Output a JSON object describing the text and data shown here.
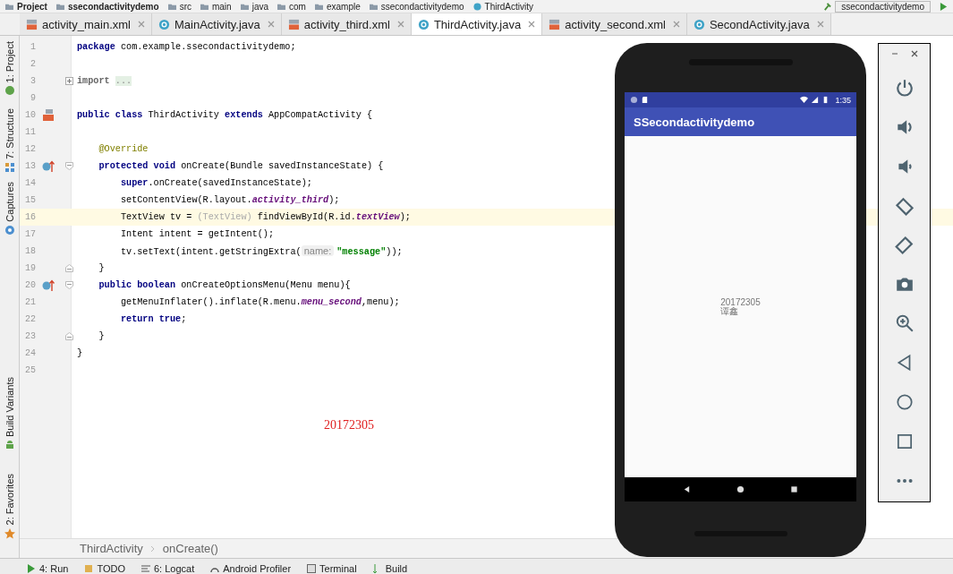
{
  "nav_bar": {
    "crumbs": [
      {
        "label": "Project",
        "kind": "project"
      },
      {
        "label": "ssecondactivitydemo",
        "kind": "module"
      },
      {
        "label": "src",
        "kind": "folder"
      },
      {
        "label": "main",
        "kind": "folder"
      },
      {
        "label": "java",
        "kind": "folder"
      },
      {
        "label": "com",
        "kind": "folder"
      },
      {
        "label": "example",
        "kind": "folder"
      },
      {
        "label": "ssecondactivitydemo",
        "kind": "folder"
      },
      {
        "label": "ThirdActivity",
        "kind": "class"
      }
    ],
    "run_config": "ssecondactivitydemo"
  },
  "tabs": [
    {
      "label": "activity_main.xml",
      "kind": "xml",
      "selected": false
    },
    {
      "label": "MainActivity.java",
      "kind": "java",
      "selected": false
    },
    {
      "label": "activity_third.xml",
      "kind": "xml",
      "selected": false
    },
    {
      "label": "ThirdActivity.java",
      "kind": "java",
      "selected": true
    },
    {
      "label": "activity_second.xml",
      "kind": "xml",
      "selected": false
    },
    {
      "label": "SecondActivity.java",
      "kind": "java",
      "selected": false
    }
  ],
  "left_tools": [
    {
      "label": "1: Project",
      "kind": "project"
    },
    {
      "label": "7: Structure",
      "kind": "structure"
    },
    {
      "label": "Captures",
      "kind": "captures"
    },
    {
      "label": "Build Variants",
      "kind": "variants"
    },
    {
      "label": "2: Favorites",
      "kind": "favorites"
    }
  ],
  "code_lines": [
    {
      "number": "1",
      "tokens": [
        {
          "text": "package",
          "kind": "keyword"
        },
        {
          "text": " com.example.ssecondactivitydemo;",
          "kind": "plain"
        }
      ]
    },
    {
      "number": "2"
    },
    {
      "number": "3",
      "folded": true,
      "tokens": [
        {
          "text": "import ",
          "kind": "import"
        },
        {
          "text": "...",
          "kind": "folded"
        }
      ]
    },
    {
      "number": "9"
    },
    {
      "number": "10",
      "class_marker": true,
      "tokens": [
        {
          "text": "public class",
          "kind": "keyword"
        },
        {
          "text": " ThirdActivity ",
          "kind": "plain"
        },
        {
          "text": "extends",
          "kind": "keyword"
        },
        {
          "text": " AppCompatActivity {",
          "kind": "plain"
        }
      ]
    },
    {
      "number": "11"
    },
    {
      "number": "12",
      "tokens": [
        {
          "text": "    @Override",
          "kind": "annotation"
        }
      ]
    },
    {
      "number": "13",
      "override_marker": true,
      "fold_start": true,
      "tokens": [
        {
          "text": "    protected void",
          "kind": "keyword"
        },
        {
          "text": " onCreate(Bundle savedInstanceState) {",
          "kind": "plain"
        }
      ]
    },
    {
      "number": "14",
      "tokens": [
        {
          "text": "        super",
          "kind": "keyword"
        },
        {
          "text": ".onCreate(savedInstanceState);",
          "kind": "plain"
        }
      ]
    },
    {
      "number": "15",
      "tokens": [
        {
          "text": "        setContentView(R.layout.",
          "kind": "plain"
        },
        {
          "text": "activity_third",
          "kind": "field"
        },
        {
          "text": ");",
          "kind": "plain"
        }
      ]
    },
    {
      "number": "16",
      "highlighted": true,
      "tokens": [
        {
          "text": "        TextView tv = ",
          "kind": "plain"
        },
        {
          "text": "(TextView)",
          "kind": "cast"
        },
        {
          "text": " findViewById(R.id.",
          "kind": "plain"
        },
        {
          "text": "textView",
          "kind": "field"
        },
        {
          "text": ");",
          "kind": "plain"
        }
      ]
    },
    {
      "number": "17",
      "tokens": [
        {
          "text": "        Intent intent = getIntent();",
          "kind": "plain"
        }
      ]
    },
    {
      "number": "18",
      "tokens": [
        {
          "text": "        tv.setText(intent.getStringExtra(",
          "kind": "plain"
        },
        {
          "text": "name:",
          "kind": "hint"
        },
        {
          "text": "\"message\"",
          "kind": "string"
        },
        {
          "text": "));",
          "kind": "plain"
        }
      ]
    },
    {
      "number": "19",
      "fold_end": true,
      "tokens": [
        {
          "text": "    }",
          "kind": "plain"
        }
      ]
    },
    {
      "number": "20",
      "override_marker": true,
      "fold_start": true,
      "tokens": [
        {
          "text": "    public boolean",
          "kind": "keyword"
        },
        {
          "text": " onCreateOptionsMenu(Menu menu){",
          "kind": "plain"
        }
      ]
    },
    {
      "number": "21",
      "tokens": [
        {
          "text": "        getMenuInflater().inflate(R.menu.",
          "kind": "plain"
        },
        {
          "text": "menu_second",
          "kind": "field"
        },
        {
          "text": ",menu);",
          "kind": "plain"
        }
      ]
    },
    {
      "number": "22",
      "tokens": [
        {
          "text": "        return true",
          "kind": "keyword"
        },
        {
          "text": ";",
          "kind": "plain"
        }
      ]
    },
    {
      "number": "23",
      "fold_end": true,
      "tokens": [
        {
          "text": "    }",
          "kind": "plain"
        }
      ]
    },
    {
      "number": "24",
      "tokens": [
        {
          "text": "}",
          "kind": "plain"
        }
      ]
    },
    {
      "number": "25"
    }
  ],
  "editor_note": "20172305",
  "breadcrumb": [
    "ThirdActivity",
    "onCreate()"
  ],
  "bottom_tools": [
    {
      "label": "4: Run",
      "kind": "run"
    },
    {
      "label": "TODO",
      "kind": "todo"
    },
    {
      "label": "6: Logcat",
      "kind": "logcat"
    },
    {
      "label": "Android Profiler",
      "kind": "profiler"
    },
    {
      "label": "Terminal",
      "kind": "terminal"
    },
    {
      "label": "Build",
      "kind": "build"
    }
  ],
  "phone": {
    "time": "1:35",
    "app_title": "SSecondactivitydemo",
    "content_lines": [
      "20172305",
      "谭鑫"
    ]
  },
  "emulator_controls": [
    {
      "kind": "power"
    },
    {
      "kind": "volume-up"
    },
    {
      "kind": "volume-down"
    },
    {
      "kind": "rotate-left"
    },
    {
      "kind": "rotate-right"
    },
    {
      "kind": "camera"
    },
    {
      "kind": "zoom"
    },
    {
      "kind": "back"
    },
    {
      "kind": "home"
    },
    {
      "kind": "overview"
    },
    {
      "kind": "more"
    }
  ]
}
